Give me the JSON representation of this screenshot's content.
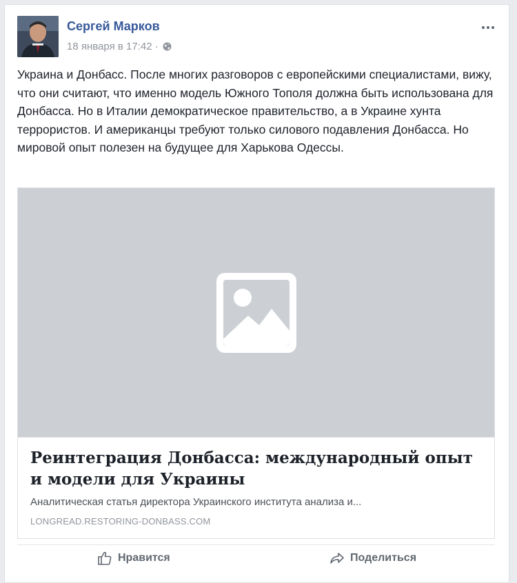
{
  "post": {
    "author_name": "Сергей Марков",
    "timestamp": "18 января в 17:42 ·",
    "text": "Украина и Донбасс. После многих разговоров с европейскими специалистами, вижу, что они считают, что именно модель Южного Тополя должна быть использована для Донбасса. Но в Италии демократическое правительство, а в Украине хунта террористов. И американцы требуют только силового подавления Донбасса. Но мировой опыт полезен на будущее для Харькова Одессы.",
    "privacy_icon": "globe-icon",
    "more_icon": "ellipsis-icon"
  },
  "link_preview": {
    "image_icon": "image-placeholder-icon",
    "title": "Реинтеграция Донбасса: международный опыт и модели для Украины",
    "description": "Аналитическая статья директора Украинского института анализа и...",
    "domain": "LONGREAD.RESTORING-DONBASS.COM"
  },
  "actions": {
    "like_label": "Нравится",
    "like_icon": "thumbs-up-icon",
    "share_label": "Поделиться",
    "share_icon": "share-arrow-icon"
  },
  "colors": {
    "author_link": "#365899",
    "meta_text": "#90949c",
    "image_placeholder_bg": "#ccd0d5"
  }
}
